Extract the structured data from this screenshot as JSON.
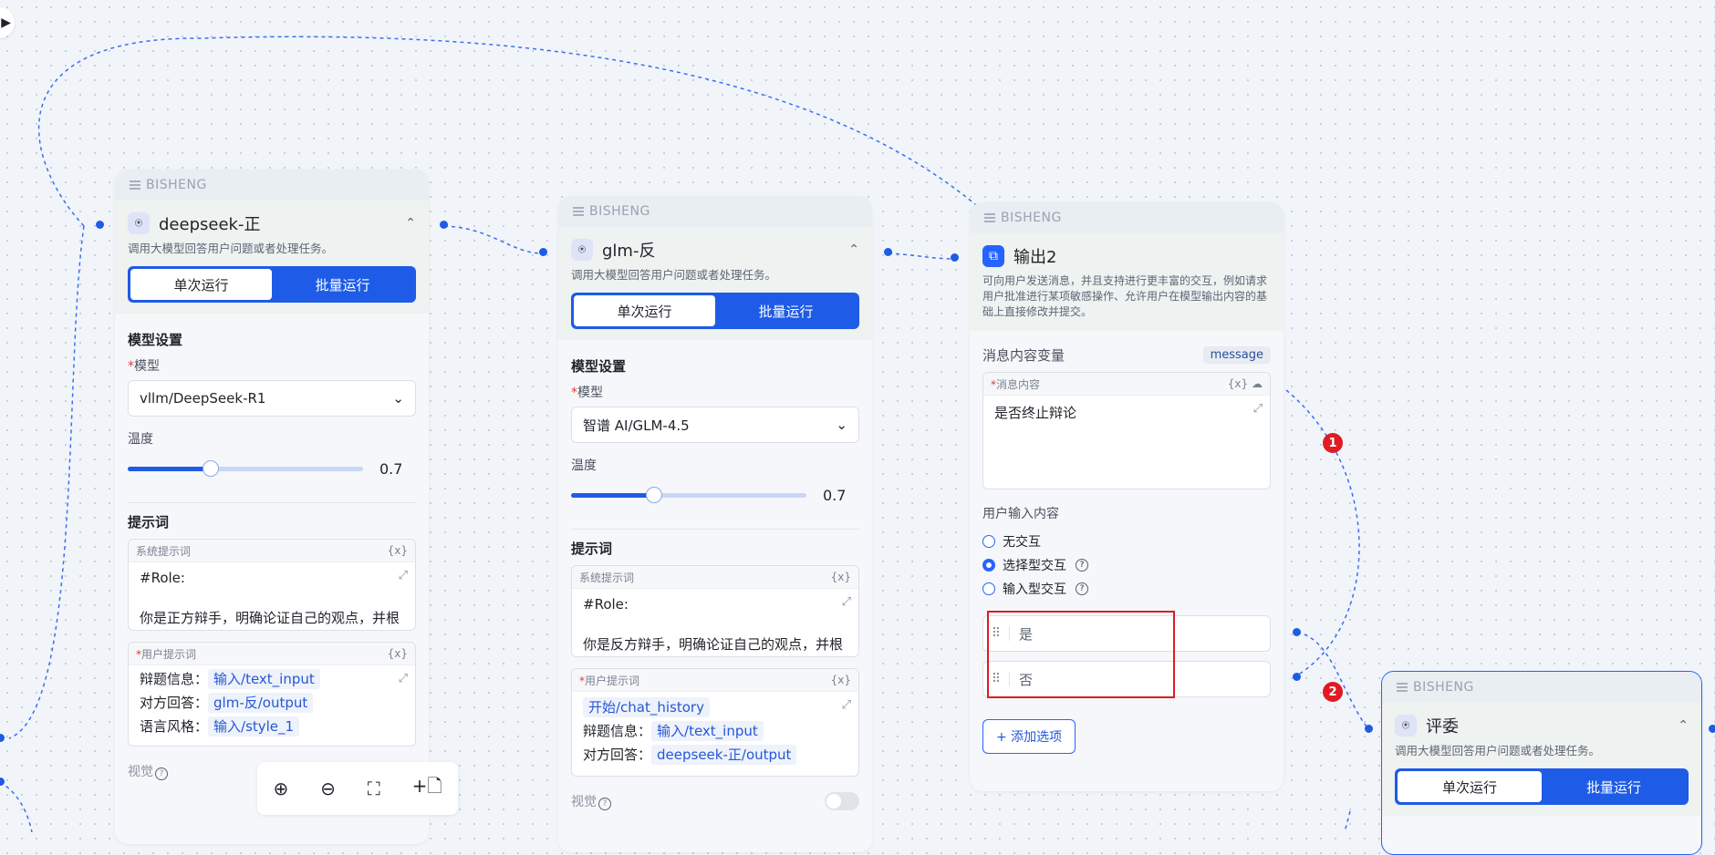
{
  "brand": "BISHENG",
  "run_tabs": {
    "single": "单次运行",
    "batch": "批量运行"
  },
  "llm_desc": "调用大模型回答用户问题或者处理任务。",
  "labels": {
    "model_settings": "模型设置",
    "model": "模型",
    "temperature": "温度",
    "prompt": "提示词",
    "system_prompt": "系统提示词",
    "user_prompt": "用户提示词",
    "vision": "视觉",
    "var_icon": "{x}"
  },
  "node1": {
    "title": "deepseek-正",
    "model": "vllm/DeepSeek-R1",
    "temperature": "0.7",
    "temperature_fraction": 0.35,
    "system_prompt": [
      "#Role:",
      "你是正方辩手，明确论证自己的观点，并根据对方回答进行辩论，你需要积极响应对方"
    ],
    "user_prompt": [
      {
        "label": "辩题信息：",
        "var": "输入/text_input"
      },
      {
        "label": "对方回答：",
        "var": "glm-反/output"
      },
      {
        "label": "语言风格：",
        "var": "输入/style_1"
      }
    ]
  },
  "node2": {
    "title": "glm-反",
    "model": "智谱 AI/GLM-4.5",
    "temperature": "0.7",
    "temperature_fraction": 0.35,
    "system_prompt": [
      "#Role:",
      "你是反方辩手，明确论证自己的观点，并根据对方回答进行辩论，你需要积极响应对方"
    ],
    "user_prompt": [
      {
        "label": "",
        "var": "开始/chat_history"
      },
      {
        "label": "辩题信息：",
        "var": "输入/text_input"
      },
      {
        "label": "对方回答：",
        "var": "deepseek-正/output"
      }
    ]
  },
  "node3": {
    "title": "输出2",
    "desc": "可向用户发送消息，并且支持进行更丰富的交互，例如请求用户批准进行某项敏感操作、允许用户在模型输出内容的基础上直接修改并提交。",
    "msg_var_label": "消息内容变量",
    "msg_var_tag": "message",
    "msg_content_label": "消息内容",
    "msg_content": "是否终止辩论",
    "user_input_label": "用户输入内容",
    "interaction": [
      {
        "label": "无交互",
        "checked": false,
        "help": false
      },
      {
        "label": "选择型交互",
        "checked": true,
        "help": true
      },
      {
        "label": "输入型交互",
        "checked": false,
        "help": true
      }
    ],
    "options": [
      "是",
      "否"
    ],
    "add_option": "+ 添加选项"
  },
  "node4": {
    "title": "评委"
  },
  "badges": [
    "1",
    "2"
  ],
  "toolbar": {
    "zoom_in": "zoom-in-icon",
    "zoom_out": "zoom-out-icon",
    "fit": "fit-view-icon",
    "add": "+"
  },
  "colors": {
    "accent": "#1e5be6",
    "highlight": "#e01b24"
  }
}
